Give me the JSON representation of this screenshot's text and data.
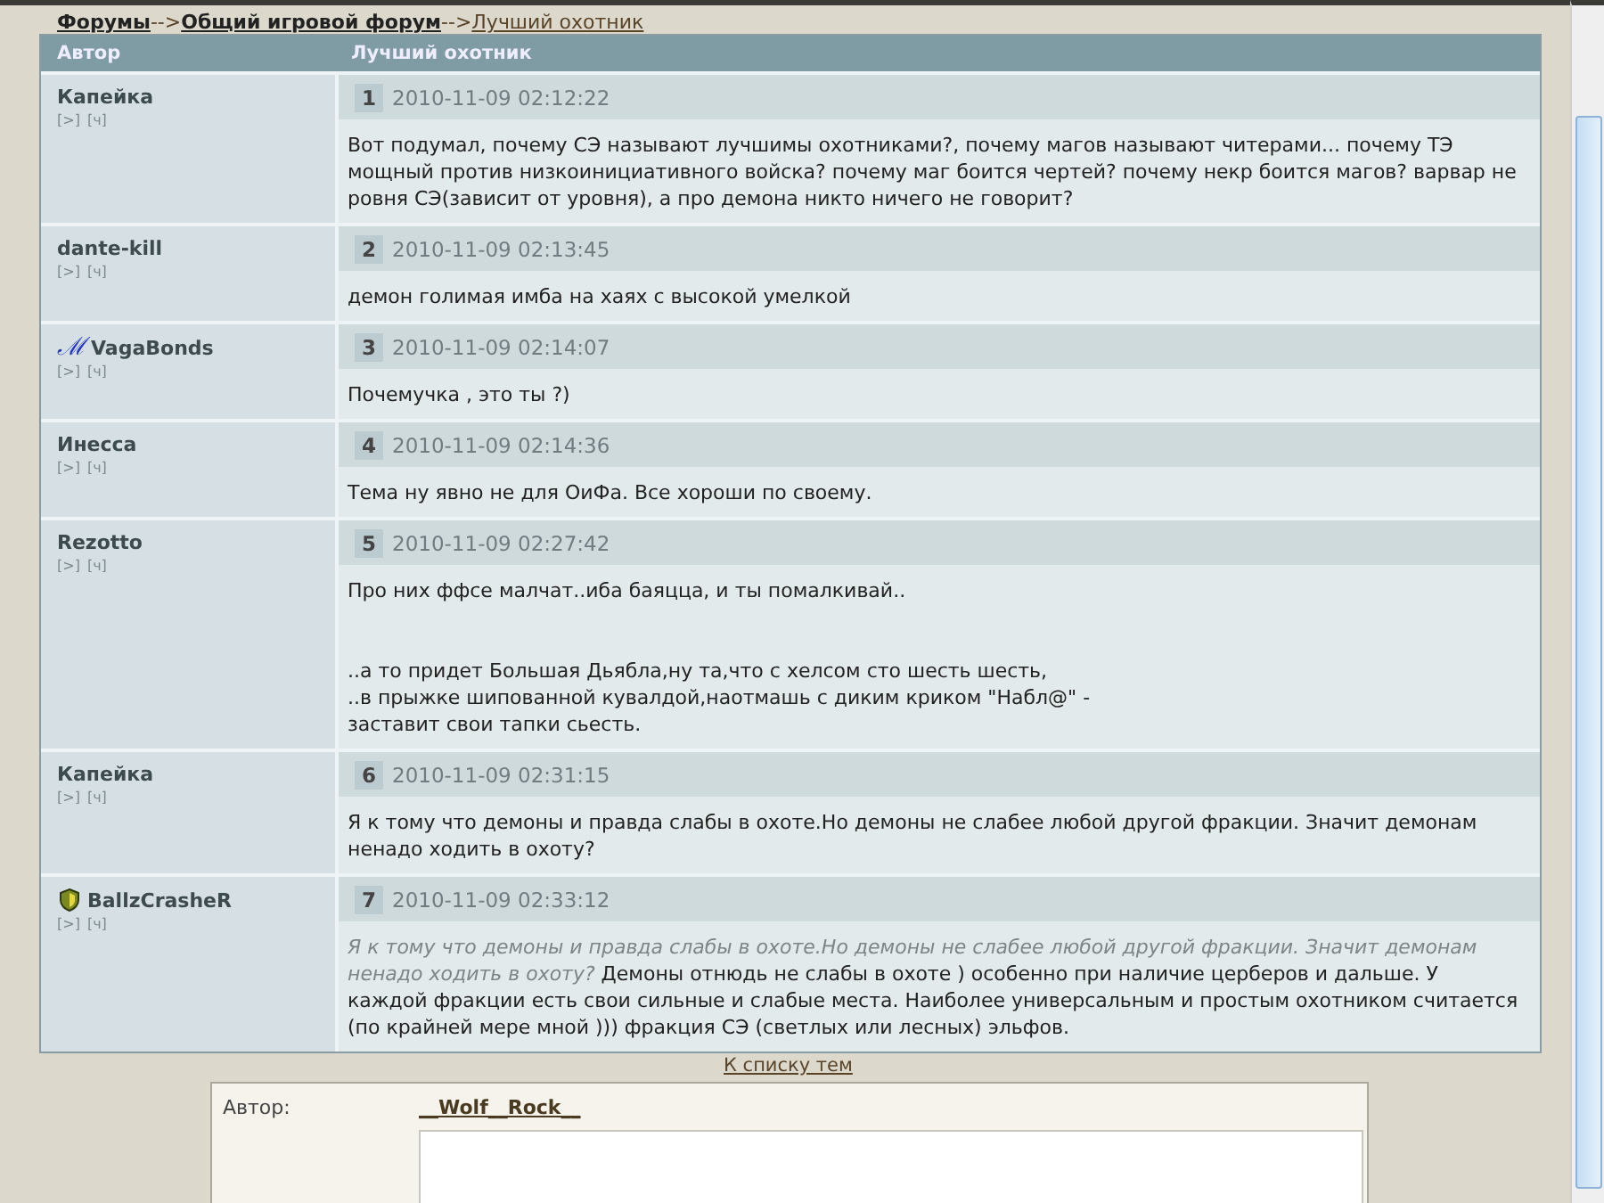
{
  "breadcrumb": [
    {
      "label": "Форумы",
      "current": false
    },
    {
      "label": "Общий игровой форум",
      "current": false
    },
    {
      "label": "Лучший охотник",
      "current": true
    }
  ],
  "breadcrumb_separator": "-->",
  "table": {
    "columns": [
      "Автор",
      "Лучший охотник"
    ],
    "posts": [
      {
        "author": "Капейка",
        "links": [
          "[>]",
          "[ч]"
        ],
        "number": "1",
        "time": "2010-11-09 02:12:22",
        "body": "Вот подумал, почему СЭ называют лучшимы охотниками?, почему магов называют читерами... почему ТЭ мощный против низкоинициативного войска? почему маг боится чертей? почему некр боится магов? варвар не ровня СЭ(зависит от уровня), а про демона никто ничего не говорит?"
      },
      {
        "author": "dante-kill",
        "links": [
          "[>]",
          "[ч]"
        ],
        "number": "2",
        "time": "2010-11-09 02:13:45",
        "body": "демон голимая имба на хаях с высокой умелкой"
      },
      {
        "author": "VagaBonds",
        "badge": {
          "kind": "glyph",
          "text": "ℳ"
        },
        "links": [
          "[>]",
          "[ч]"
        ],
        "number": "3",
        "time": "2010-11-09 02:14:07",
        "body": "Почемучка , это ты ?)"
      },
      {
        "author": "Инесса",
        "links": [
          "[>]",
          "[ч]"
        ],
        "number": "4",
        "time": "2010-11-09 02:14:36",
        "body": "Тема ну явно не для ОиФа. Все хороши по своему."
      },
      {
        "author": "Rezotto",
        "links": [
          "[>]",
          "[ч]"
        ],
        "number": "5",
        "time": "2010-11-09 02:27:42",
        "body": "Про них ффсе малчат..иба баяцца, и ты помалкивай..\n\n\n..а то придет Большая Дьябла,ну та,что с хелсом сто шесть шесть,\n..в прыжке шипованной кувалдой,наотмашь с диким криком \"Набл@\" -\nзаставит свои тапки сьесть."
      },
      {
        "author": "Капейка",
        "links": [
          "[>]",
          "[ч]"
        ],
        "number": "6",
        "time": "2010-11-09 02:31:15",
        "body": "Я к тому что демоны и правда слабы в охоте.Но демоны не слабее любой другой фракции. Значит демонам ненадо ходить в охоту?"
      },
      {
        "author": "BallzCrasheR",
        "badge": {
          "kind": "shield"
        },
        "links": [
          "[>]",
          "[ч]"
        ],
        "number": "7",
        "time": "2010-11-09 02:33:12",
        "body": "*Я к тому что демоны и правда слабы в охоте.Но демоны не слабее любой другой фракции. Значит демонам ненадо ходить в охоту?* Демоны отнюдь не слабы в охоте ) особенно при наличие церберов и дальше. У каждой фракции есть свои сильные и слабые места. Наиболее универсальным и простым охотником считается (по крайней мере мной ))) фракция СЭ (светлых или лесных) эльфов."
      }
    ]
  },
  "back_link": "К списку тем",
  "reply_form": {
    "author_label": "Автор:",
    "author_name": "__Wolf__Rock__"
  }
}
